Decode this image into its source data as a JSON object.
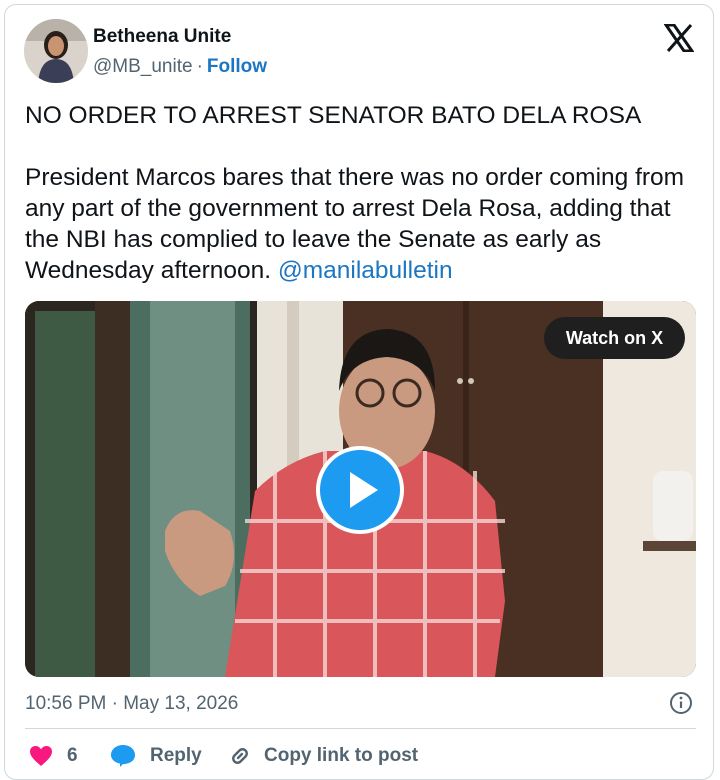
{
  "author": {
    "name": "Betheena Unite",
    "handle": "@MB_unite",
    "separator": "·",
    "follow_label": "Follow"
  },
  "tweet": {
    "headline": "NO ORDER TO ARREST SENATOR BATO DELA ROSA",
    "body": "President Marcos bares that there was no order coming from any part of the government to arrest Dela Rosa, adding that the NBI has complied to leave the Senate as early as Wednesday afternoon. ",
    "mention": "@manilabulletin"
  },
  "media": {
    "watch_label": "Watch on X"
  },
  "meta": {
    "timestamp": "10:56 PM · May 13, 2026"
  },
  "actions": {
    "like_count": "6",
    "reply_label": "Reply",
    "copy_label": "Copy link to post"
  },
  "colors": {
    "accent": "#1d9bf0",
    "link": "#1d76c2",
    "like": "#f91880",
    "muted": "#536471"
  },
  "icons": [
    "x-logo-icon",
    "info-icon",
    "heart-icon",
    "reply-bubble-icon",
    "link-icon",
    "play-icon"
  ]
}
